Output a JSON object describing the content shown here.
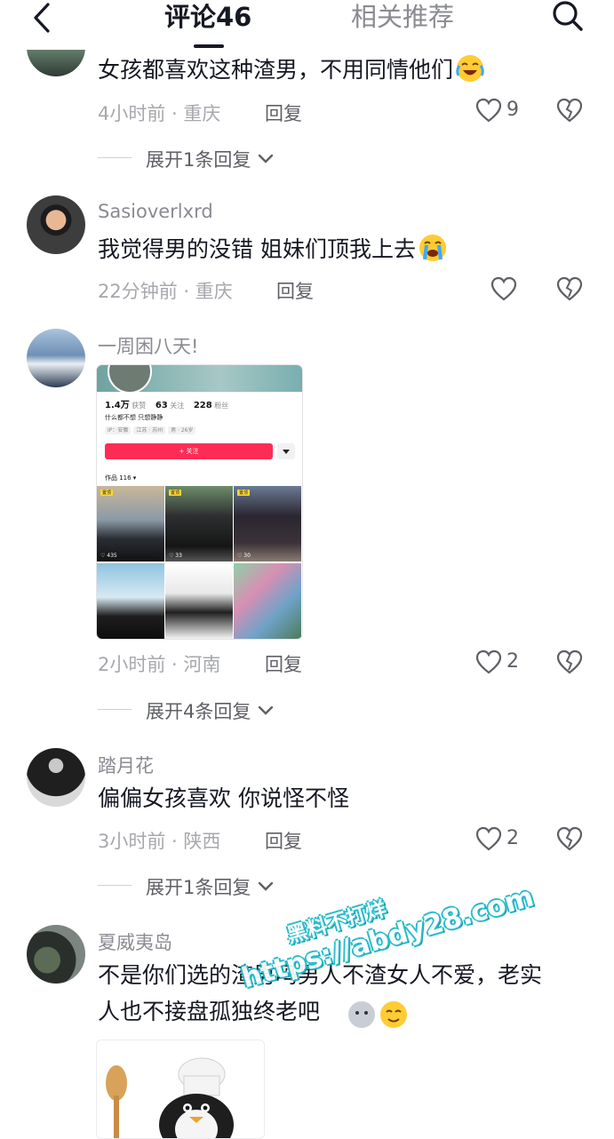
{
  "header": {
    "tab_comments": "评论46",
    "tab_recommend": "相关推荐"
  },
  "comments": [
    {
      "text": "女孩都喜欢这种渣男，不用同情他们",
      "emoji_icon": "crying-laughing-emoji",
      "time": "4小时前",
      "location": "重庆",
      "reply_label": "回复",
      "likes": "9",
      "expand": "展开1条回复"
    },
    {
      "username": "Sasioverlxrd",
      "text": "我觉得男的没错 姐妹们顶我上去",
      "emoji_icon": "crying-emoji",
      "time": "22分钟前",
      "location": "重庆",
      "reply_label": "回复"
    },
    {
      "username": "一周困八天!",
      "time": "2小时前",
      "location": "河南",
      "reply_label": "回复",
      "likes": "2",
      "expand": "展开4条回复",
      "screenshot": {
        "stats": [
          {
            "num": "1.4万",
            "label": "获赞"
          },
          {
            "num": "63",
            "label": "关注"
          },
          {
            "num": "228",
            "label": "粉丝"
          }
        ],
        "bio": "什么都不想 只想静静",
        "tags": [
          "IP：安徽",
          "江苏 · 苏州",
          "男 · 26岁"
        ],
        "follow": "+ 关注",
        "works": "作品 116 ▾",
        "pin_label": "置顶",
        "cell_counts": [
          "435",
          "33",
          "30"
        ]
      }
    },
    {
      "username": "踏月花",
      "text": "偏偏女孩喜欢 你说怪不怪",
      "time": "3小时前",
      "location": "陕西",
      "reply_label": "回复",
      "likes": "2",
      "expand": "展开1条回复"
    },
    {
      "username": "夏威夷岛",
      "text_line1": "不是你们选的渣男吗男人不渣女人不爱，老实",
      "text_line2": "人也不接盘孤独终老吧"
    }
  ],
  "watermark": {
    "line1": "黑料不打烊",
    "line2": "https://abdy28.com"
  },
  "colors": {
    "primary_text": "#161823",
    "secondary_text": "#8a8b91",
    "accent": "#fe2c55",
    "watermark": "#16b7c8"
  }
}
